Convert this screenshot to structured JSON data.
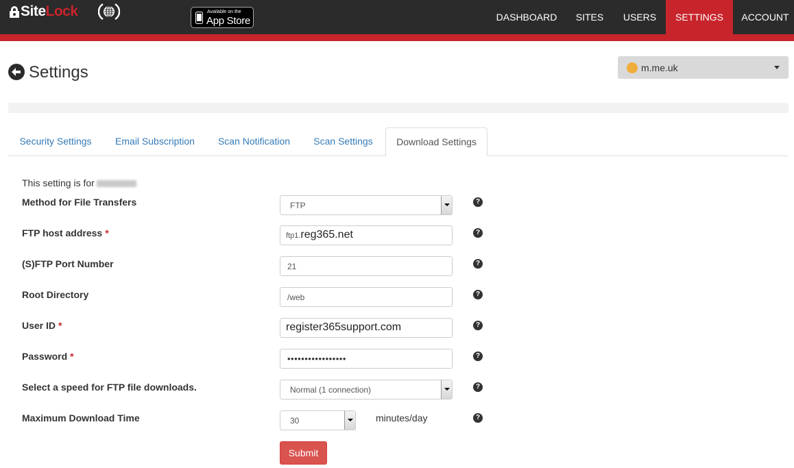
{
  "brand": {
    "site": "Site",
    "lock": "Lock",
    "tm": "."
  },
  "appstore": {
    "small": "Available on the",
    "big": "App Store"
  },
  "nav": {
    "dashboard": "DASHBOARD",
    "sites": "SITES",
    "users": "USERS",
    "settings": "SETTINGS",
    "account": "ACCOUNT"
  },
  "header": {
    "title": "Settings",
    "domain": "m.me.uk"
  },
  "tabs": [
    "Security Settings",
    "Email Subscription",
    "Scan Notification",
    "Scan Settings",
    "Download Settings"
  ],
  "form": {
    "intro": "This setting is for",
    "method_label": "Method for File Transfers",
    "method_value": "FTP",
    "host_label": "FTP host address",
    "host_prefix": "ftp1.",
    "host_value": "reg365.net",
    "port_label": "(S)FTP Port Number",
    "port_value": "21",
    "root_label": "Root Directory",
    "root_value": "/web",
    "user_label": "User ID",
    "user_value": "register365support.com",
    "password_label": "Password",
    "password_value": "•••••••••••••••••",
    "speed_label": "Select a speed for FTP file downloads.",
    "speed_value": "Normal (1 connection)",
    "time_label": "Maximum Download Time",
    "time_value": "30",
    "time_units": "minutes/day",
    "required_mark": "*",
    "help_glyph": "?",
    "submit": "Submit"
  },
  "colors": {
    "topbar": "#2b2b2b",
    "accent": "#c8242b",
    "link": "#337ab7",
    "submit": "#d9534f",
    "domain_dot": "#f0ad3a"
  },
  "icons": [
    "lock-icon",
    "globe-icon",
    "apple-icon",
    "back-arrow-icon",
    "chevron-down-icon",
    "help-icon"
  ]
}
